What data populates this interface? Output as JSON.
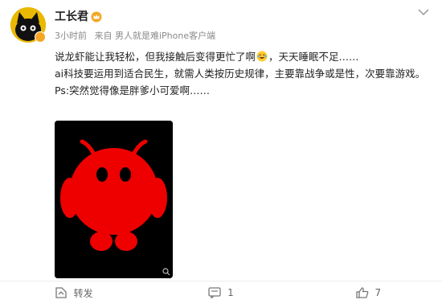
{
  "post": {
    "username": "工长君",
    "meta": {
      "time": "3小时前",
      "source": "来自 男人就是难iPhone客户端"
    },
    "paragraphs": [
      {
        "before": "说龙虾能让我轻松，但我接触后变得更忙了啊",
        "emoji": "laugh-cry-emoji",
        "after": "，天天睡眠不足……"
      },
      {
        "before": "ai科技要运用到适合民生，就需人类按历史规律，主要靠战争或是性，次要靠游戏。",
        "emoji": "",
        "after": ""
      },
      {
        "before": "Ps:突然觉得像是胖爹小可爱啊……",
        "emoji": "",
        "after": ""
      }
    ]
  },
  "actions": {
    "repost_label": "转发",
    "comment_count": "1",
    "like_count": "7"
  },
  "colors": {
    "avatar_bg": "#e9b800",
    "image_bg": "#000000",
    "figure_red": "#ee0000",
    "meta_gray": "#8a8a8a",
    "badge_orange": "#f5a623"
  }
}
